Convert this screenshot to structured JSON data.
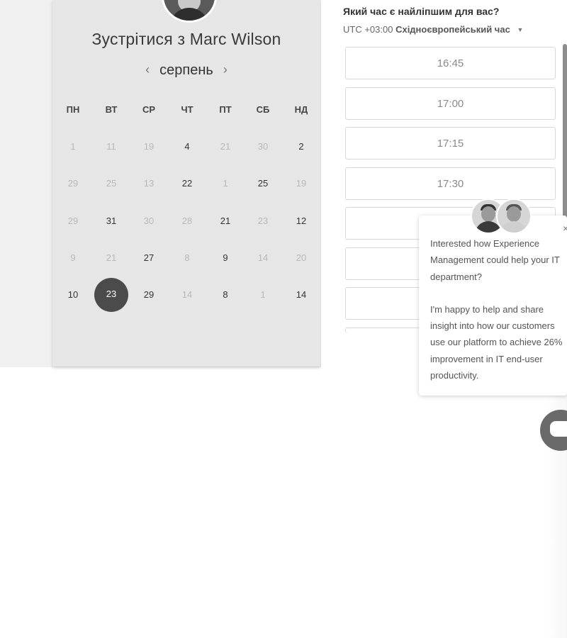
{
  "scheduler": {
    "title": "Зустрітися з Marc Wilson",
    "month": "серпень",
    "prev_month_icon": "chevron-left-icon",
    "next_month_icon": "chevron-right-icon",
    "prev_arrow": "‹",
    "next_arrow": "›",
    "weekdays": [
      "ПН",
      "ВТ",
      "СР",
      "ЧТ",
      "ПТ",
      "СБ",
      "НД"
    ],
    "weeks": [
      [
        {
          "d": "1",
          "s": "disabled"
        },
        {
          "d": "11",
          "s": "disabled"
        },
        {
          "d": "19",
          "s": "disabled"
        },
        {
          "d": "4",
          "s": "available"
        },
        {
          "d": "21",
          "s": "disabled"
        },
        {
          "d": "30",
          "s": "disabled"
        },
        {
          "d": "2",
          "s": "available"
        }
      ],
      [
        {
          "d": "29",
          "s": "disabled"
        },
        {
          "d": "25",
          "s": "disabled"
        },
        {
          "d": "13",
          "s": "disabled"
        },
        {
          "d": "22",
          "s": "available"
        },
        {
          "d": "1",
          "s": "disabled"
        },
        {
          "d": "25",
          "s": "available"
        },
        {
          "d": "19",
          "s": "disabled"
        }
      ],
      [
        {
          "d": "29",
          "s": "disabled"
        },
        {
          "d": "31",
          "s": "available"
        },
        {
          "d": "30",
          "s": "disabled"
        },
        {
          "d": "28",
          "s": "disabled"
        },
        {
          "d": "21",
          "s": "available"
        },
        {
          "d": "23",
          "s": "disabled"
        },
        {
          "d": "12",
          "s": "available"
        }
      ],
      [
        {
          "d": "9",
          "s": "disabled"
        },
        {
          "d": "21",
          "s": "disabled"
        },
        {
          "d": "27",
          "s": "available"
        },
        {
          "d": "8",
          "s": "disabled"
        },
        {
          "d": "9",
          "s": "available"
        },
        {
          "d": "14",
          "s": "disabled"
        },
        {
          "d": "20",
          "s": "disabled"
        }
      ],
      [
        {
          "d": "10",
          "s": "available"
        },
        {
          "d": "23",
          "s": "selected"
        },
        {
          "d": "29",
          "s": "available"
        },
        {
          "d": "14",
          "s": "disabled"
        },
        {
          "d": "8",
          "s": "available"
        },
        {
          "d": "1",
          "s": "disabled"
        },
        {
          "d": "14",
          "s": "available"
        }
      ]
    ]
  },
  "times": {
    "question": "Який час є найліпшим для вас?",
    "tz_offset": "UTC +03:00",
    "tz_name": "Східноєвропейський час",
    "slots": [
      "16:45",
      "17:00",
      "17:15",
      "17:30",
      "",
      "",
      ""
    ]
  },
  "chat": {
    "message_1": "Interested how Experience Management could help your IT department?",
    "message_2": "I'm happy to help and share insight into how our customers use our platform to achieve 26% improvement in IT end-user productivity.",
    "close_label": "×",
    "launcher_icon": "chat-icon"
  }
}
